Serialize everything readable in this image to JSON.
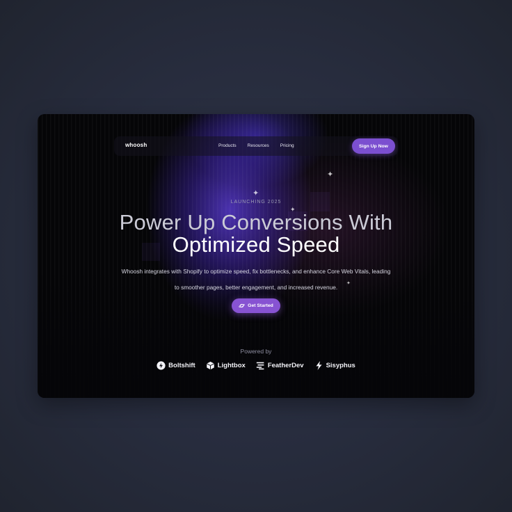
{
  "colors": {
    "accent": "#7b4fd0",
    "background": "#272c3d",
    "frame": "#050507",
    "text": "#ffffff",
    "muted": "#9c9cb4"
  },
  "nav": {
    "logo": "whoosh",
    "links": [
      "Products",
      "Resources",
      "Pricing"
    ],
    "signup_label": "Sign Up Now"
  },
  "hero": {
    "eyebrow": "LAUNCHING 2025",
    "title_line1": "Power Up Conversions With",
    "title_line2": "Optimized Speed",
    "subtitle_line1": "Whoosh integrates with Shopify to optimize speed, fix bottlenecks, and enhance Core Web Vitals, leading",
    "subtitle_line2": "to smoother pages, better engagement, and increased revenue.",
    "cta_label": "Get Started",
    "cta_icon": "planet-icon"
  },
  "partners": {
    "label": "Powered by",
    "items": [
      {
        "name": "Boltshift",
        "icon": "bolt-icon"
      },
      {
        "name": "Lightbox",
        "icon": "cube-icon"
      },
      {
        "name": "FeatherDev",
        "icon": "feather-icon"
      },
      {
        "name": "Sisyphus",
        "icon": "lightning-icon"
      }
    ]
  }
}
